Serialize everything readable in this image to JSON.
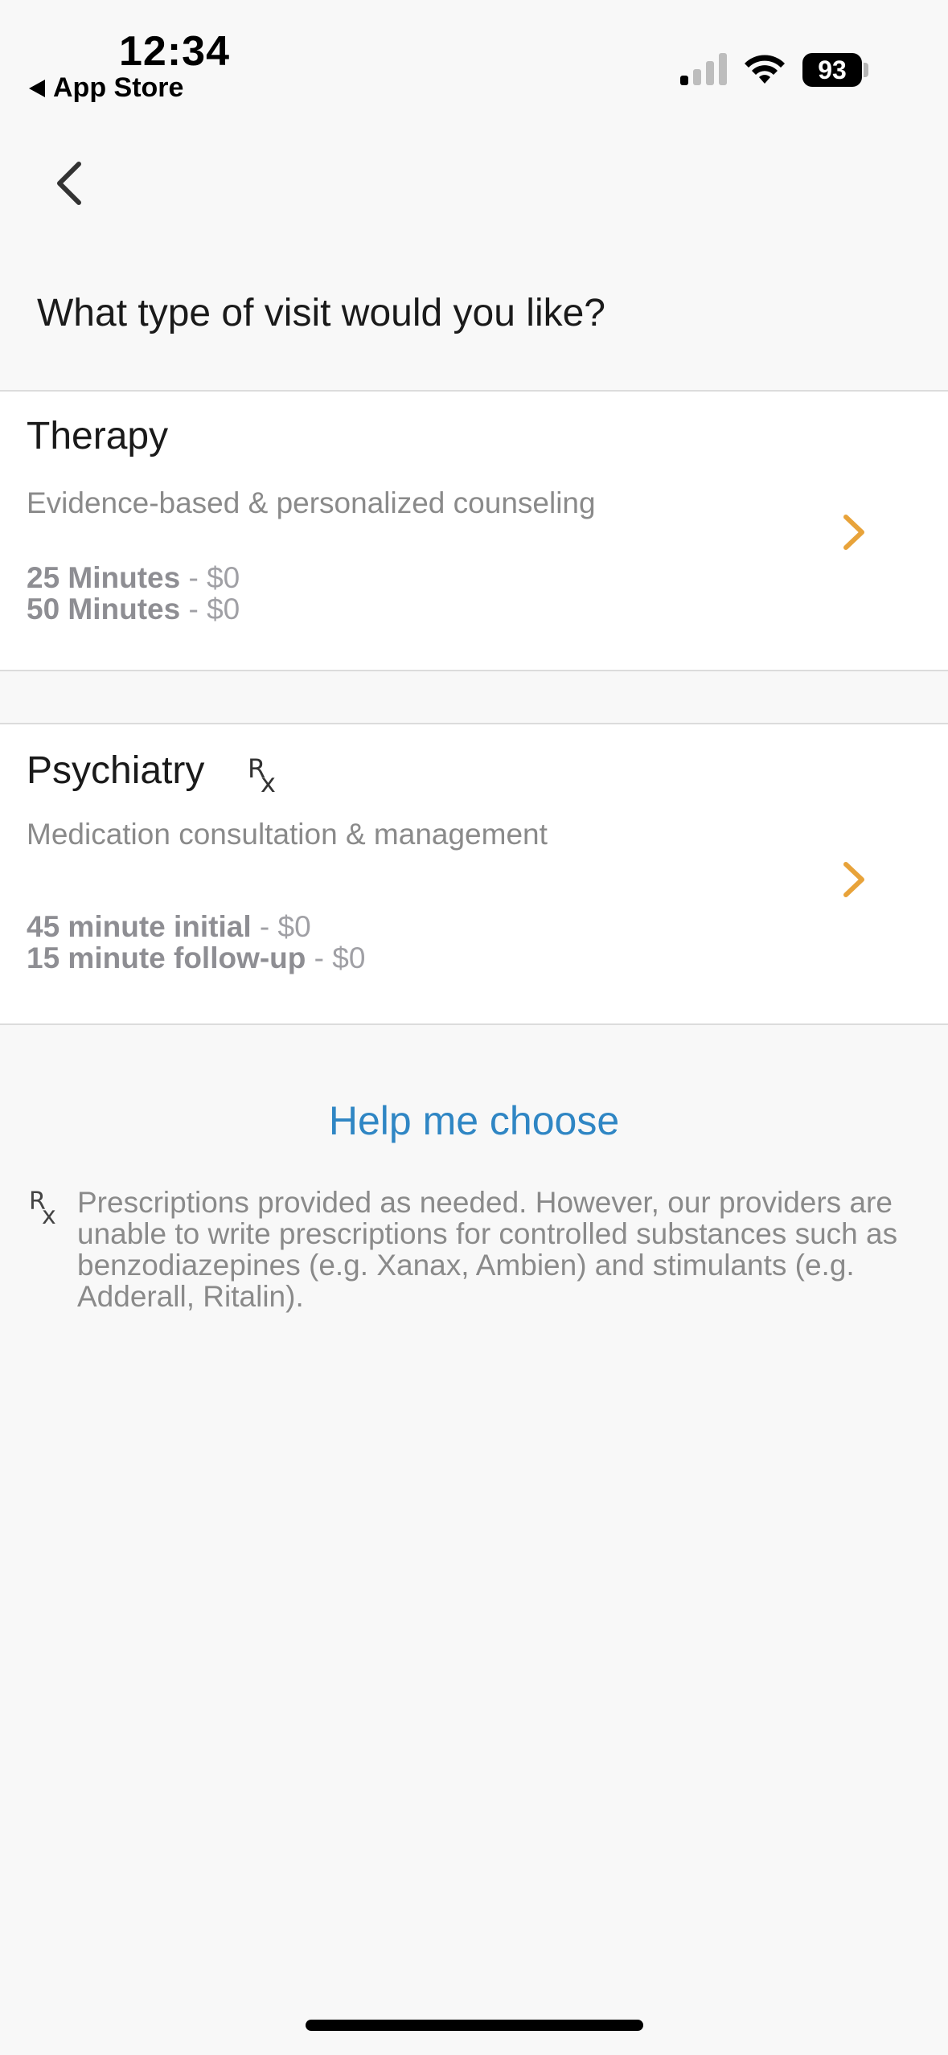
{
  "status_bar": {
    "time": "12:34",
    "back_app": "App Store",
    "battery": "93",
    "icons": [
      "signal-icon",
      "wifi-icon",
      "battery-icon"
    ]
  },
  "nav": {
    "back_icon": "chevron-left-icon"
  },
  "question": "What type of visit would you like?",
  "options": [
    {
      "title": "Therapy",
      "description": "Evidence-based & personalized counseling",
      "durations": [
        {
          "label": "25 Minutes",
          "price": " - $0"
        },
        {
          "label": "50 Minutes",
          "price": " - $0"
        }
      ]
    },
    {
      "title": "Psychiatry",
      "badge": "Rx",
      "description": "Medication consultation & management",
      "durations": [
        {
          "label": "45 minute initial",
          "price": " - $0"
        },
        {
          "label": "15 minute follow-up",
          "price": " - $0"
        }
      ]
    }
  ],
  "help_link": "Help me choose",
  "note": "Prescriptions provided as needed. However, our providers are unable to write prescriptions for controlled substances such as benzodiazepines (e.g. Xanax, Ambien) and stimulants (e.g. Adderall, Ritalin).",
  "colors": {
    "accent_chevron": "#e8a33a",
    "link": "#2f86c4",
    "background": "#f8f8f8"
  }
}
